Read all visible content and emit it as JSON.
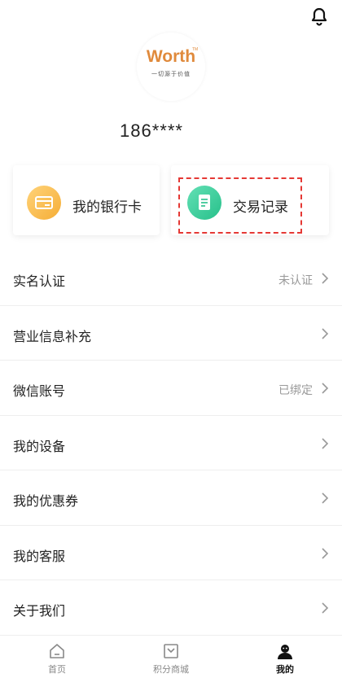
{
  "header": {
    "bell_icon": "bell-icon"
  },
  "profile": {
    "logo_word": "Worth",
    "logo_tm": "TM",
    "logo_tagline": "一切源于价值",
    "phone": "186****"
  },
  "cards": [
    {
      "label": "我的银行卡",
      "icon": "bank-card-icon",
      "color": "#f5ad35"
    },
    {
      "label": "交易记录",
      "icon": "document-icon",
      "color": "#27c08a"
    }
  ],
  "menu": [
    {
      "label": "实名认证",
      "status": "未认证"
    },
    {
      "label": "营业信息补充",
      "status": ""
    },
    {
      "label": "微信账号",
      "status": "已绑定"
    },
    {
      "label": "我的设备",
      "status": ""
    },
    {
      "label": "我的优惠券",
      "status": ""
    },
    {
      "label": "我的客服",
      "status": ""
    },
    {
      "label": "关于我们",
      "status": ""
    }
  ],
  "tabbar": [
    {
      "label": "首页",
      "icon": "home-icon",
      "active": false
    },
    {
      "label": "积分商城",
      "icon": "shop-icon",
      "active": false
    },
    {
      "label": "我的",
      "icon": "profile-icon",
      "active": true
    }
  ],
  "colors": {
    "highlight": "#e53935",
    "text": "#222222",
    "muted": "#999999"
  }
}
